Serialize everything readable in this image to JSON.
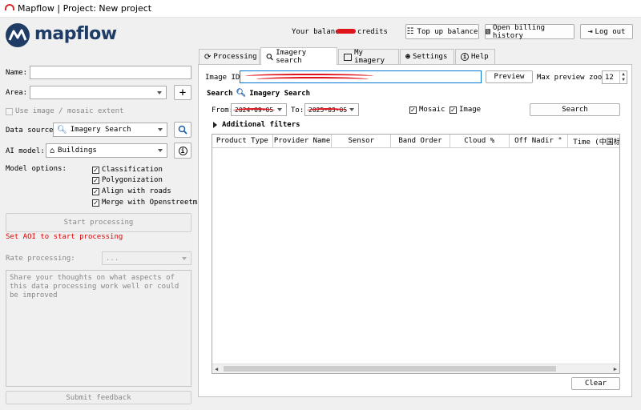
{
  "window": {
    "title": "Mapflow | Project: New project"
  },
  "brand": {
    "name": "mapflow",
    "color": "#1f3c66"
  },
  "header": {
    "balance_prefix": "Your balance:",
    "balance_suffix": "credits",
    "topup_label": "Top up balance",
    "billing_label": "Open billing history",
    "logout_label": "Log out"
  },
  "left": {
    "name_label": "Name:",
    "name_value": "",
    "area_label": "Area:",
    "area_value": "",
    "use_extent_label": "Use image / mosaic extent",
    "source_label": "Data source:",
    "source_value": "Imagery Search",
    "model_label": "AI model:",
    "model_value": "Buildings",
    "options_label": "Model options:",
    "options": [
      {
        "label": "Classification",
        "checked": true
      },
      {
        "label": "Polygonization",
        "checked": true
      },
      {
        "label": "Align with roads",
        "checked": true
      },
      {
        "label": "Merge with Openstreetmap",
        "checked": true
      }
    ],
    "start_label": "Start processing",
    "error_text": "Set AOI to start processing",
    "error_color": "#e00000",
    "rate_label": "Rate processing:",
    "rate_value": "...",
    "feedback_placeholder": "Share your thoughts on what aspects of this data processing work well or could be improved",
    "submit_label": "Submit feedback"
  },
  "tabs": [
    {
      "label": "Processing",
      "icon": "refresh-icon"
    },
    {
      "label": "Imagery search",
      "icon": "search-icon"
    },
    {
      "label": "My imagery",
      "icon": "image-icon"
    },
    {
      "label": "Settings",
      "icon": "users-icon"
    },
    {
      "label": "Help",
      "icon": "info-icon"
    }
  ],
  "imagery": {
    "image_id_label": "Image ID:",
    "preview_label": "Preview",
    "zoom_label": "Max preview zoom:",
    "zoom_value": "12",
    "search_title_prefix": "Search",
    "search_title_suffix": "Imagery Search",
    "from_label": "From:",
    "from_value": "2024-09-05",
    "to_label": "To:",
    "to_value": "2025-03-05",
    "mosaic_label": "Mosaic",
    "image_label": "Image",
    "search_label": "Search",
    "filters_label": "Additional filters",
    "columns": [
      "Product Type",
      "Provider Name",
      "Sensor",
      "Band Order",
      "Cloud %",
      "Off Nadir °",
      "Time (中国标"
    ],
    "clear_label": "Clear"
  }
}
